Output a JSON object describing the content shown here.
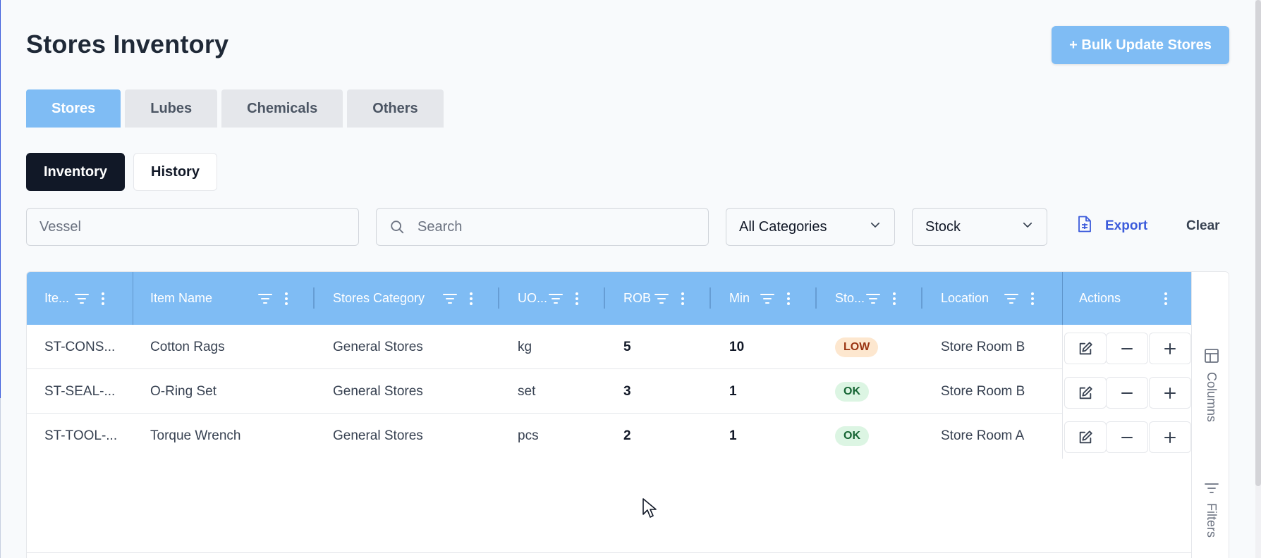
{
  "page": {
    "title": "Stores Inventory",
    "bulk_button": "+ Bulk Update Stores"
  },
  "category_tabs": [
    {
      "label": "Stores",
      "active": true
    },
    {
      "label": "Lubes",
      "active": false
    },
    {
      "label": "Chemicals",
      "active": false
    },
    {
      "label": "Others",
      "active": false
    }
  ],
  "view_tabs": [
    {
      "label": "Inventory",
      "active": true
    },
    {
      "label": "History",
      "active": false
    }
  ],
  "filters": {
    "vessel_placeholder": "Vessel",
    "search_placeholder": "Search",
    "category_value": "All Categories",
    "stock_value": "Stock",
    "export_label": "Export",
    "clear_label": "Clear"
  },
  "columns": [
    {
      "label": "Ite..."
    },
    {
      "label": "Item Name"
    },
    {
      "label": "Stores Category"
    },
    {
      "label": "UO..."
    },
    {
      "label": "ROB"
    },
    {
      "label": "Min"
    },
    {
      "label": "Sto..."
    },
    {
      "label": "Location"
    },
    {
      "label": "Actions"
    }
  ],
  "rows": [
    {
      "code": "ST-CONS...",
      "name": "Cotton Rags",
      "category": "General Stores",
      "uom": "kg",
      "rob": "5",
      "min": "10",
      "status": "LOW",
      "location": "Store Room B"
    },
    {
      "code": "ST-SEAL-...",
      "name": "O-Ring Set",
      "category": "General Stores",
      "uom": "set",
      "rob": "3",
      "min": "1",
      "status": "OK",
      "location": "Store Room B"
    },
    {
      "code": "ST-TOOL-...",
      "name": "Torque Wrench",
      "category": "General Stores",
      "uom": "pcs",
      "rob": "2",
      "min": "1",
      "status": "OK",
      "location": "Store Room A"
    }
  ],
  "side_panel": {
    "columns_label": "Columns",
    "filters_label": "Filters"
  },
  "colors": {
    "accent": "#7fbcf4",
    "dark": "#111827",
    "link": "#3b5bdb",
    "low_bg": "#fde7cf",
    "ok_bg": "#dcf5e3"
  }
}
